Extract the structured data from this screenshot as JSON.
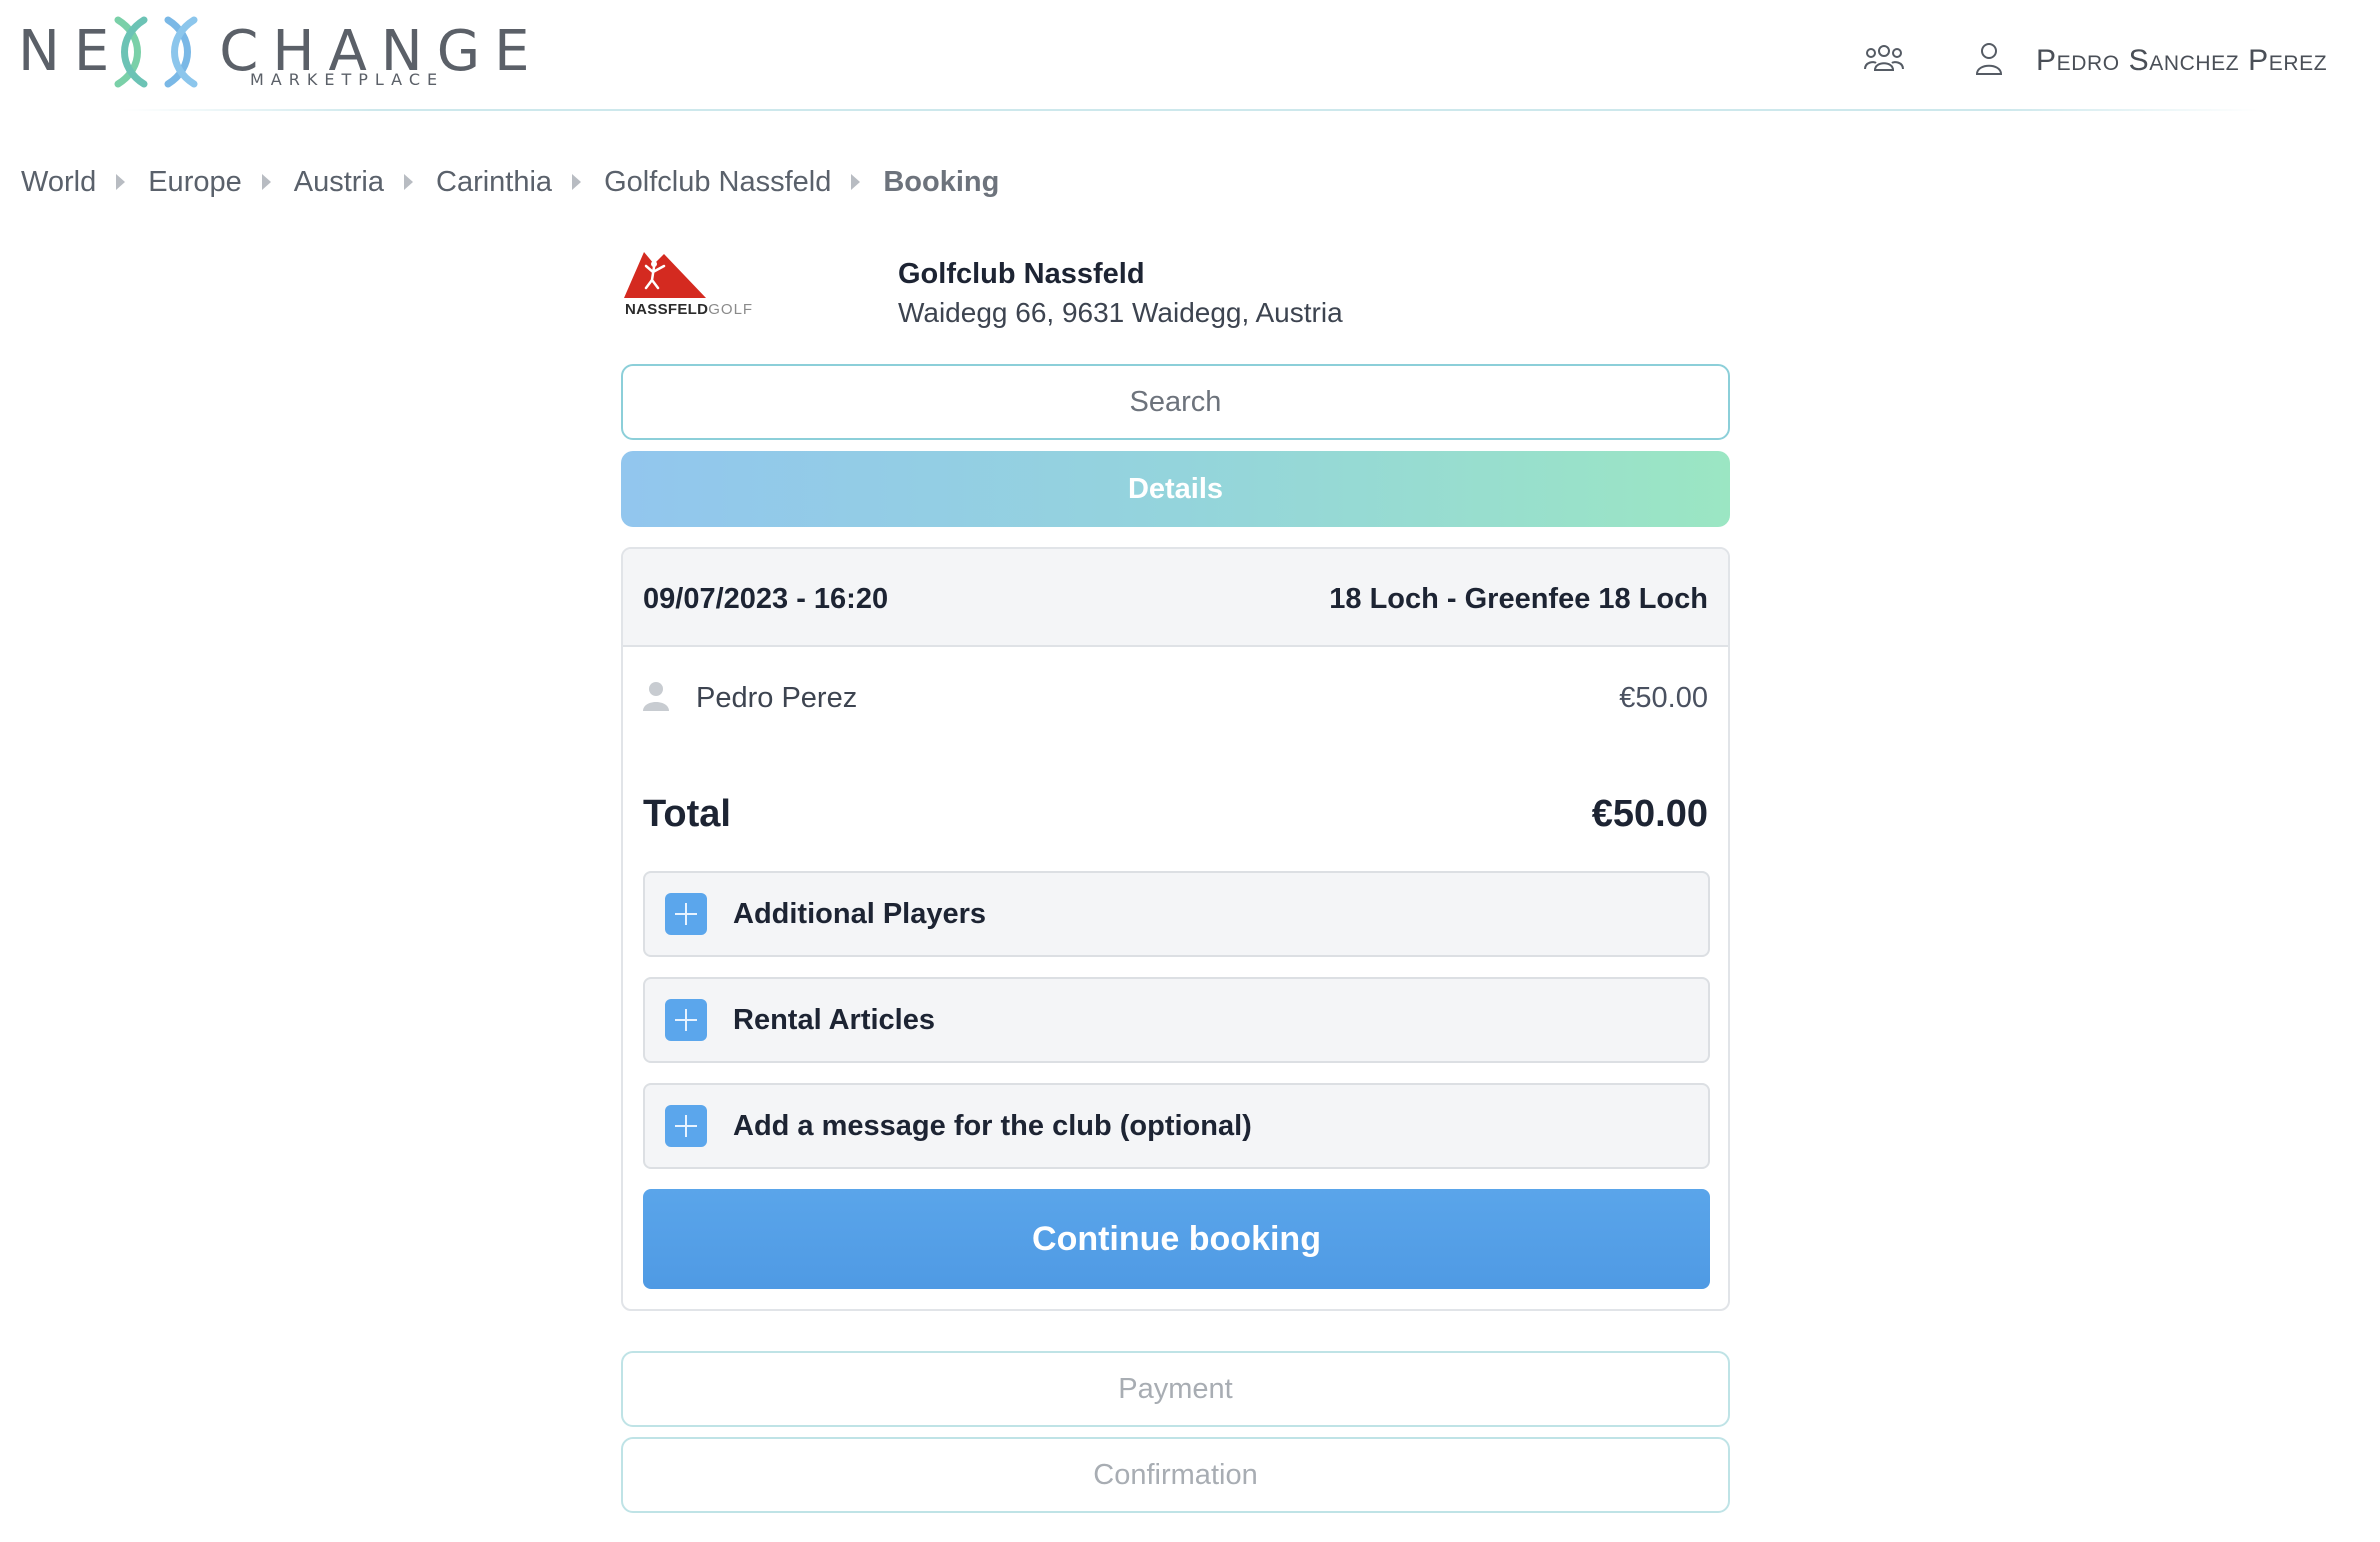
{
  "header": {
    "logo_left": "NE",
    "logo_right": "CHANGE",
    "logo_sub": "MARKETPLACE",
    "user_name": "Pedro Sanchez Perez",
    "icons": [
      "group-icon",
      "user-icon"
    ]
  },
  "breadcrumb": [
    "World",
    "Europe",
    "Austria",
    "Carinthia",
    "Golfclub Nassfeld",
    "Booking"
  ],
  "club": {
    "logo_text_bold": "NASSFELD",
    "logo_text_light": "GOLF",
    "name": "Golfclub Nassfeld",
    "address": "Waidegg 66, 9631 Waidegg, Austria"
  },
  "steps": {
    "search": "Search",
    "details": "Details",
    "payment": "Payment",
    "confirmation": "Confirmation"
  },
  "booking": {
    "datetime": "09/07/2023 - 16:20",
    "product": "18 Loch - Greenfee 18 Loch",
    "player_name": "Pedro Perez",
    "player_price": "€50.00",
    "total_label": "Total",
    "total_value": "€50.00"
  },
  "accordions": [
    {
      "label": "Additional Players"
    },
    {
      "label": "Rental Articles"
    },
    {
      "label": "Add a message for the club (optional)"
    }
  ],
  "continue_label": "Continue booking",
  "colors": {
    "accent_blue": "#5aa5ea",
    "gradient_start": "#92c6ee",
    "gradient_end": "#9be6c3",
    "logo_teal": "#6cc3b5",
    "logo_blue": "#7ab8e6",
    "club_red": "#d42a20"
  }
}
